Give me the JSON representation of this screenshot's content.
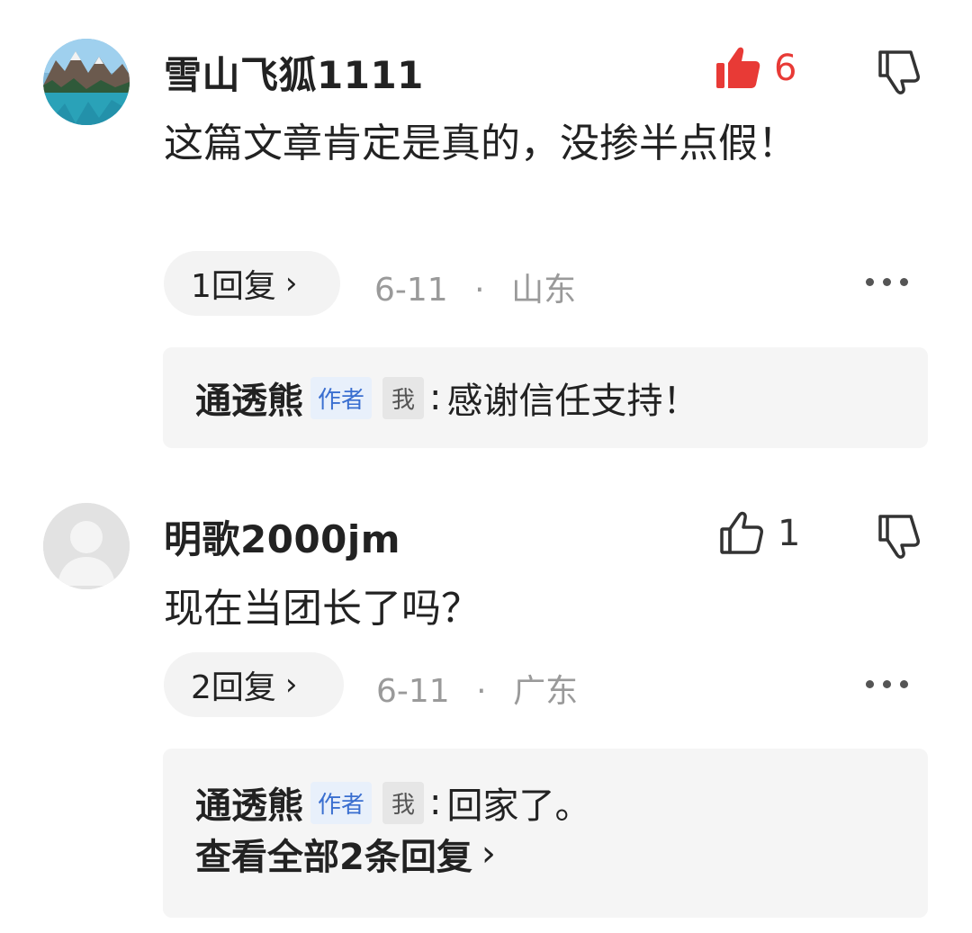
{
  "comments": [
    {
      "username": "雪山飞狐1111",
      "content": "这篇文章肯定是真的，没掺半点假！",
      "like_count": "6",
      "liked": true,
      "reply_count_label": "1回复",
      "date": "6-11",
      "separator": "·",
      "location": "山东",
      "avatar_icon": "mountain-lake-avatar",
      "replies": [
        {
          "author": "通透熊",
          "author_tag": "作者",
          "me_tag": "我",
          "text": "感谢信任支持！"
        }
      ]
    },
    {
      "username": "明歌2000jm",
      "content": "现在当团长了吗？",
      "like_count": "1",
      "liked": false,
      "reply_count_label": "2回复",
      "date": "6-11",
      "separator": "·",
      "location": "广东",
      "avatar_icon": "default-user-avatar",
      "replies": [
        {
          "author": "通透熊",
          "author_tag": "作者",
          "me_tag": "我",
          "text": "回家了。"
        }
      ],
      "view_all": "查看全部2条回复"
    }
  ],
  "colors": {
    "like_active": "#e83a36",
    "meta_gray": "#9a9a9a",
    "author_tag_blue": "#3a6fd0",
    "reply_bg": "#f5f5f5"
  }
}
